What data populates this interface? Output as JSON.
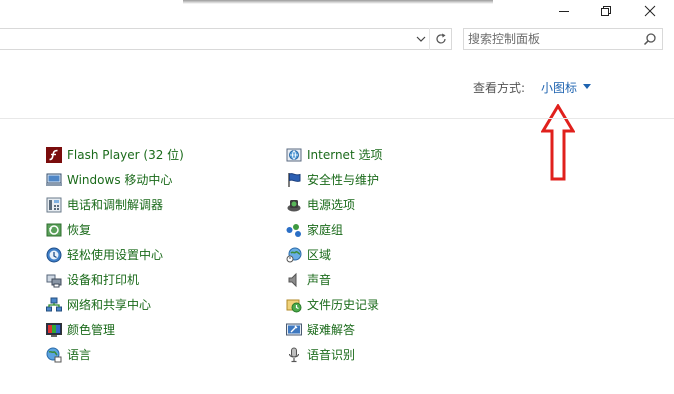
{
  "search": {
    "placeholder": "搜索控制面板"
  },
  "view_by": {
    "label": "查看方式:",
    "value": "小图标"
  },
  "columns": [
    {
      "items": [
        {
          "label": "Flash Player (32 位)",
          "icon": "flash-icon"
        },
        {
          "label": "Windows 移动中心",
          "icon": "mobility-center-icon"
        },
        {
          "label": "电话和调制解调器",
          "icon": "phone-modem-icon"
        },
        {
          "label": "恢复",
          "icon": "recovery-icon"
        },
        {
          "label": "轻松使用设置中心",
          "icon": "ease-of-access-icon"
        },
        {
          "label": "设备和打印机",
          "icon": "devices-printers-icon"
        },
        {
          "label": "网络和共享中心",
          "icon": "network-sharing-icon"
        },
        {
          "label": "颜色管理",
          "icon": "color-management-icon"
        },
        {
          "label": "语言",
          "icon": "language-icon"
        }
      ]
    },
    {
      "items": [
        {
          "label": "Internet 选项",
          "icon": "internet-options-icon"
        },
        {
          "label": "安全性与维护",
          "icon": "security-maintenance-icon"
        },
        {
          "label": "电源选项",
          "icon": "power-options-icon"
        },
        {
          "label": "家庭组",
          "icon": "homegroup-icon"
        },
        {
          "label": "区域",
          "icon": "region-icon"
        },
        {
          "label": "声音",
          "icon": "sound-icon"
        },
        {
          "label": "文件历史记录",
          "icon": "file-history-icon"
        },
        {
          "label": "疑难解答",
          "icon": "troubleshooting-icon"
        },
        {
          "label": "语音识别",
          "icon": "speech-recognition-icon"
        }
      ]
    }
  ],
  "colors": {
    "link": "#1a6a1a",
    "accent": "#1e63b0",
    "annotation": "#e0201c"
  }
}
